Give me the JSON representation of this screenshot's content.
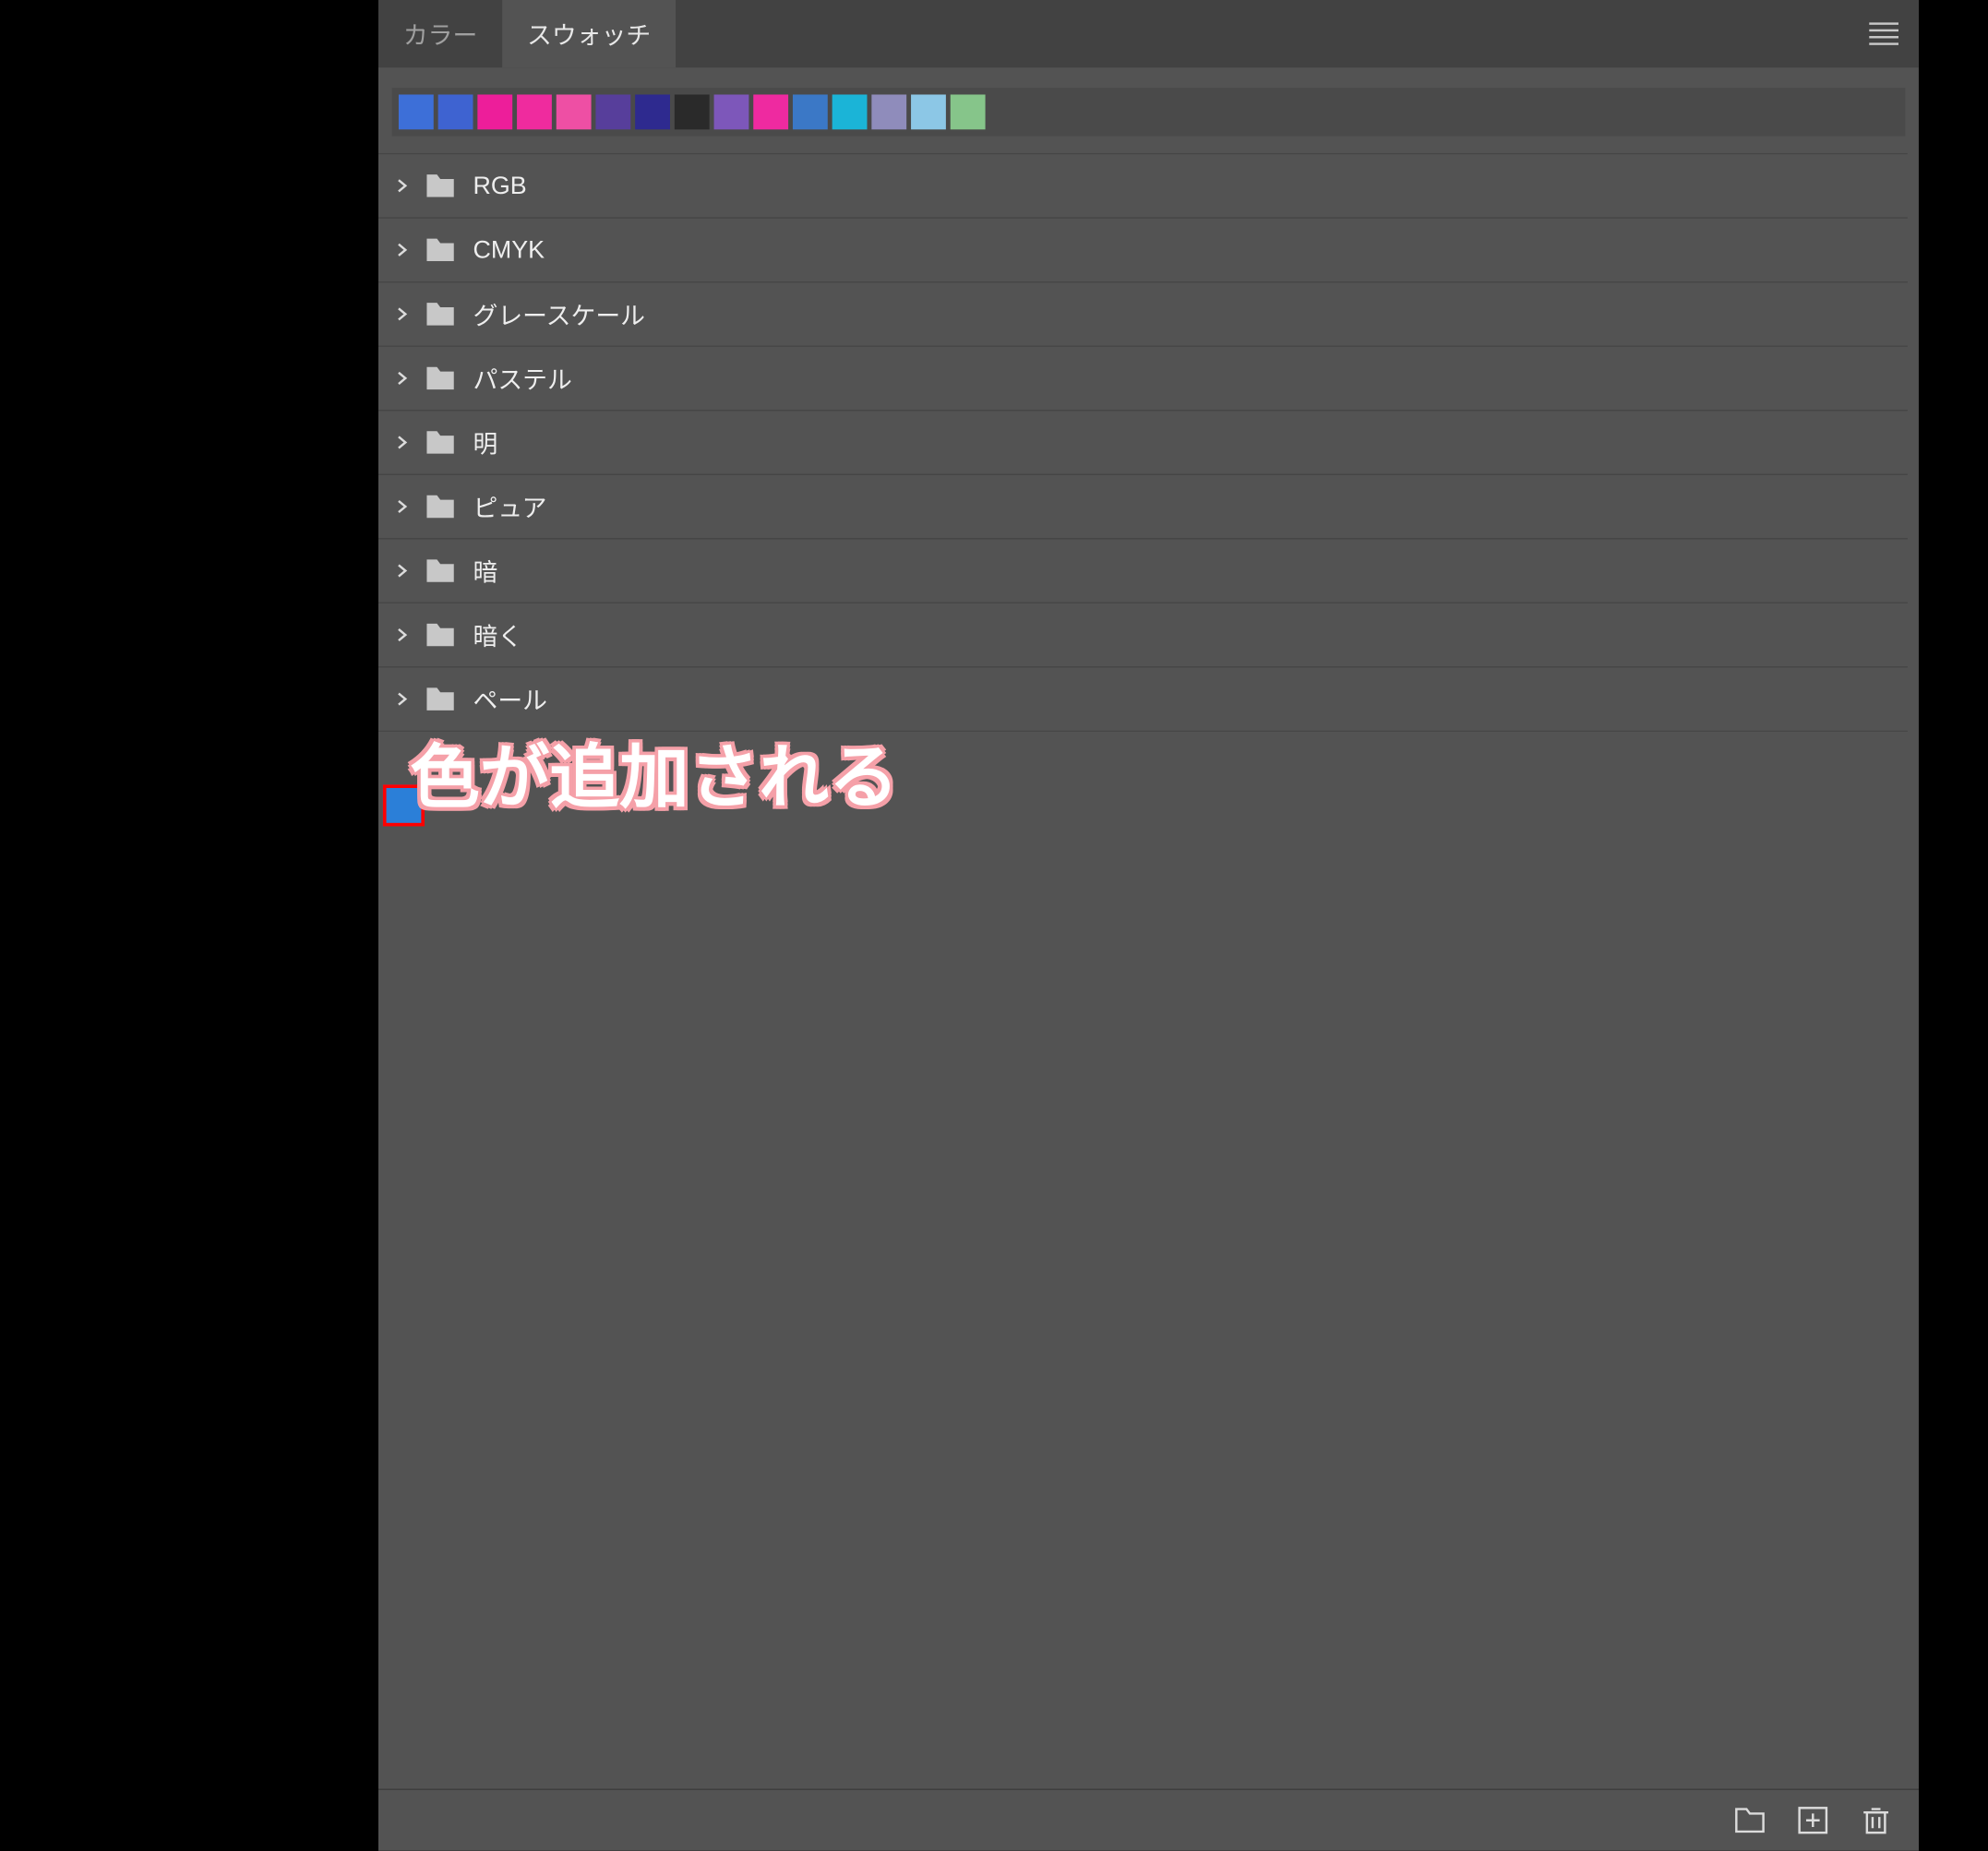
{
  "tabs": {
    "color_label": "カラー",
    "swatches_label": "スウォッチ"
  },
  "swatches": [
    {
      "color": "#3d6fd8"
    },
    {
      "color": "#3e63d1"
    },
    {
      "color": "#ed1e9a"
    },
    {
      "color": "#ef2b9e"
    },
    {
      "color": "#ee4fa4"
    },
    {
      "color": "#573e9b"
    },
    {
      "color": "#2e2a8f"
    },
    {
      "color": "#2a2a2a"
    },
    {
      "color": "#7d57ba"
    },
    {
      "color": "#ee2aa0"
    },
    {
      "color": "#3b78c6"
    },
    {
      "color": "#1bb4d7"
    },
    {
      "color": "#8f8cbb"
    },
    {
      "color": "#8cc7e6"
    },
    {
      "color": "#86c58a"
    }
  ],
  "folders": [
    {
      "label": "RGB"
    },
    {
      "label": "CMYK"
    },
    {
      "label": "グレースケール"
    },
    {
      "label": "パステル"
    },
    {
      "label": "明"
    },
    {
      "label": "ピュア"
    },
    {
      "label": "暗"
    },
    {
      "label": "暗く"
    },
    {
      "label": "ペール"
    }
  ],
  "new_swatch_color": "#2b7fd8",
  "annotation_text": "色が追加される",
  "icons": {
    "menu": "menu-lines",
    "chevron": "chevron-right-icon",
    "folder": "folder-icon",
    "folder_btn": "folder-icon",
    "new_btn": "plus-square-icon",
    "trash_btn": "trash-icon"
  }
}
